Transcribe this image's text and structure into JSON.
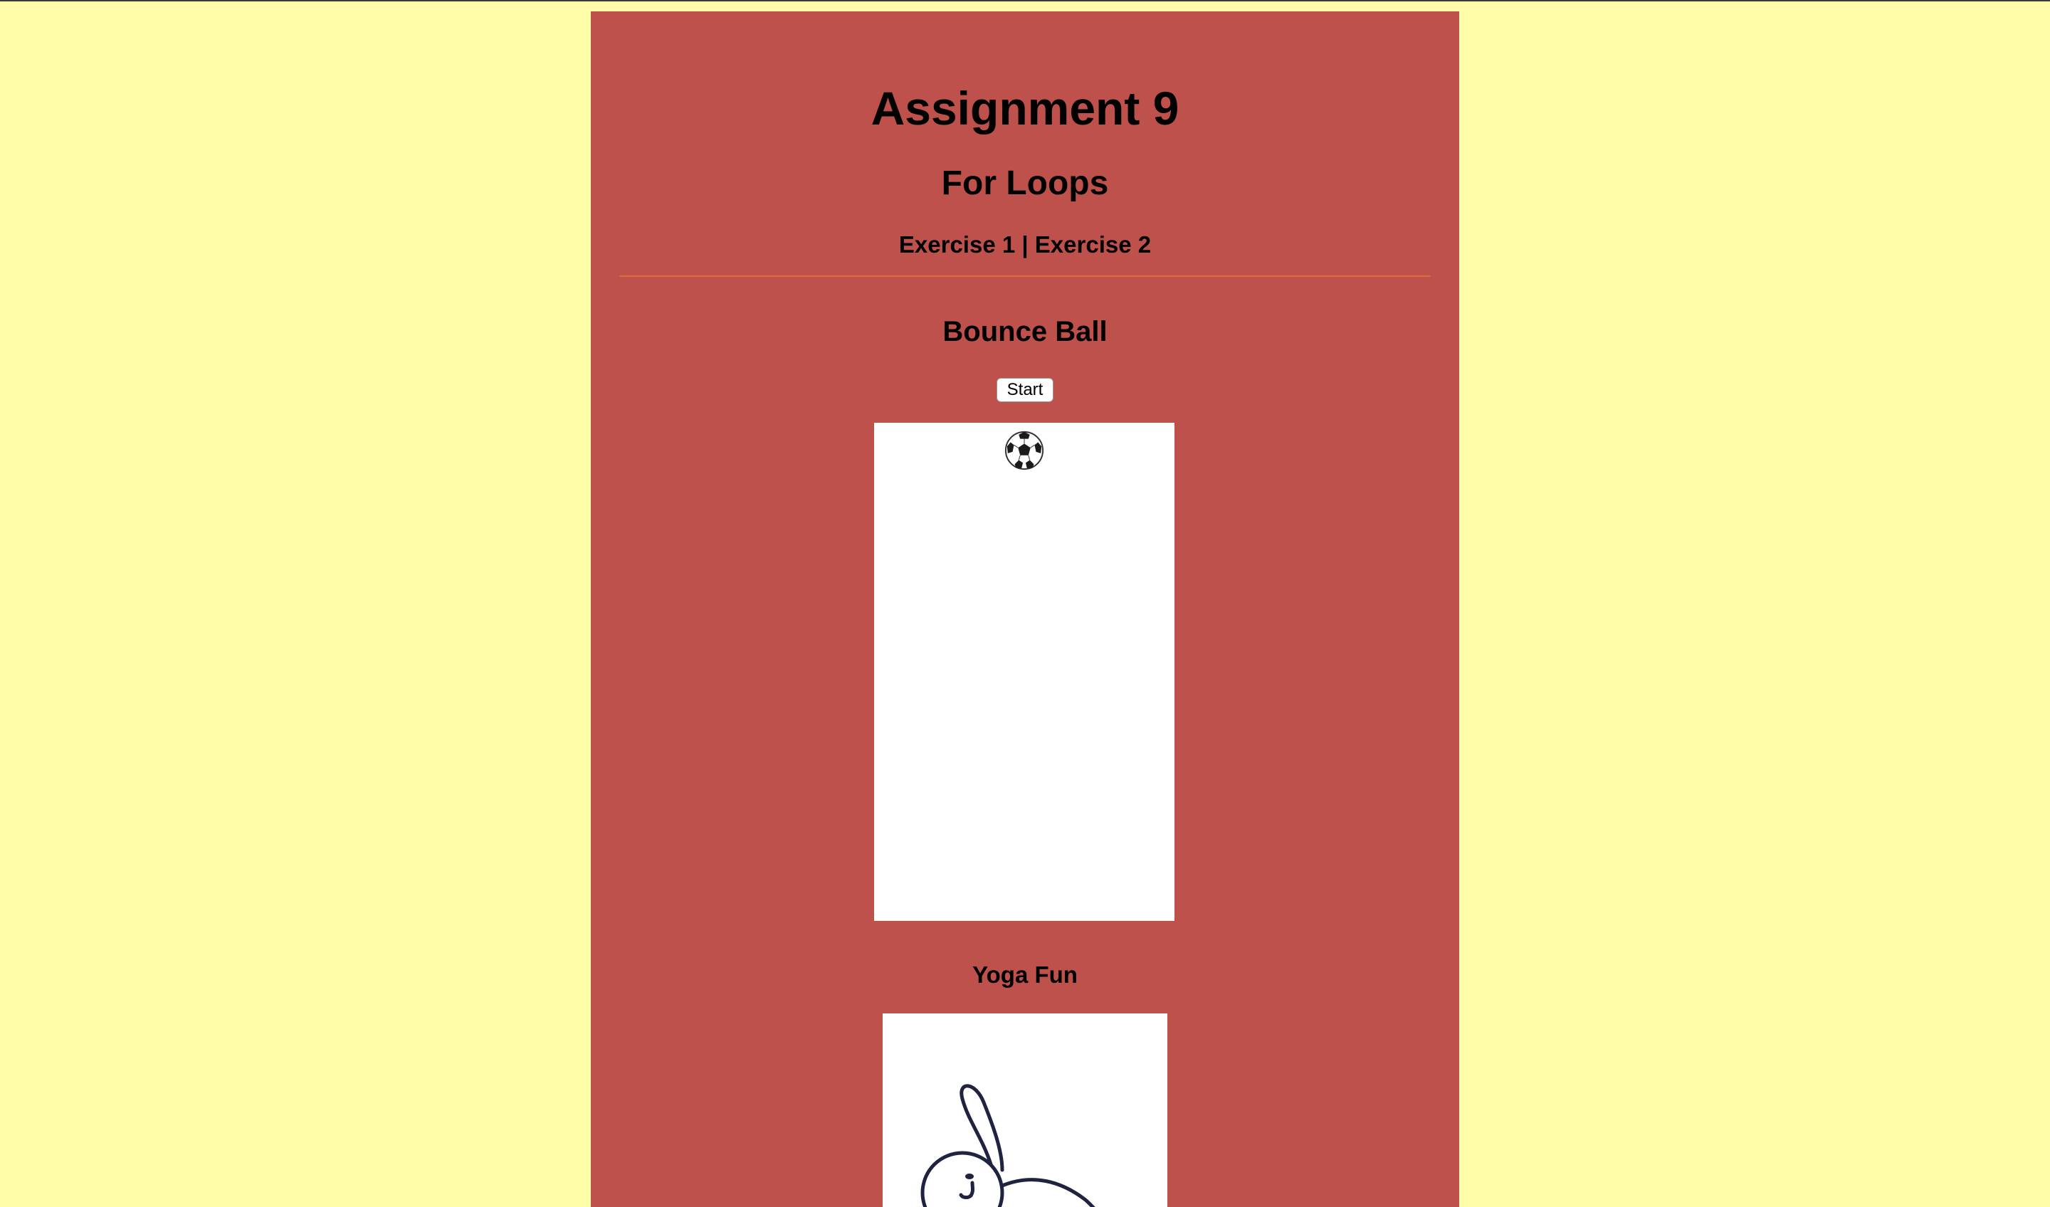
{
  "page": {
    "title": "Assignment 9",
    "subtitle": "For Loops",
    "nav": {
      "exercise1": "Exercise 1",
      "separator": " | ",
      "exercise2": "Exercise 2"
    }
  },
  "bounce": {
    "heading": "Bounce Ball",
    "start_label": "Start",
    "ball_icon": "soccer-ball-icon"
  },
  "yoga": {
    "heading": "Yoga Fun",
    "figure_icon": "yoga-figure-illustration"
  },
  "colors": {
    "page_background": "#fffda8",
    "panel_background": "#bf514c",
    "divider": "#e06a3a",
    "canvas": "#ffffff",
    "ink": "#1f2340"
  }
}
